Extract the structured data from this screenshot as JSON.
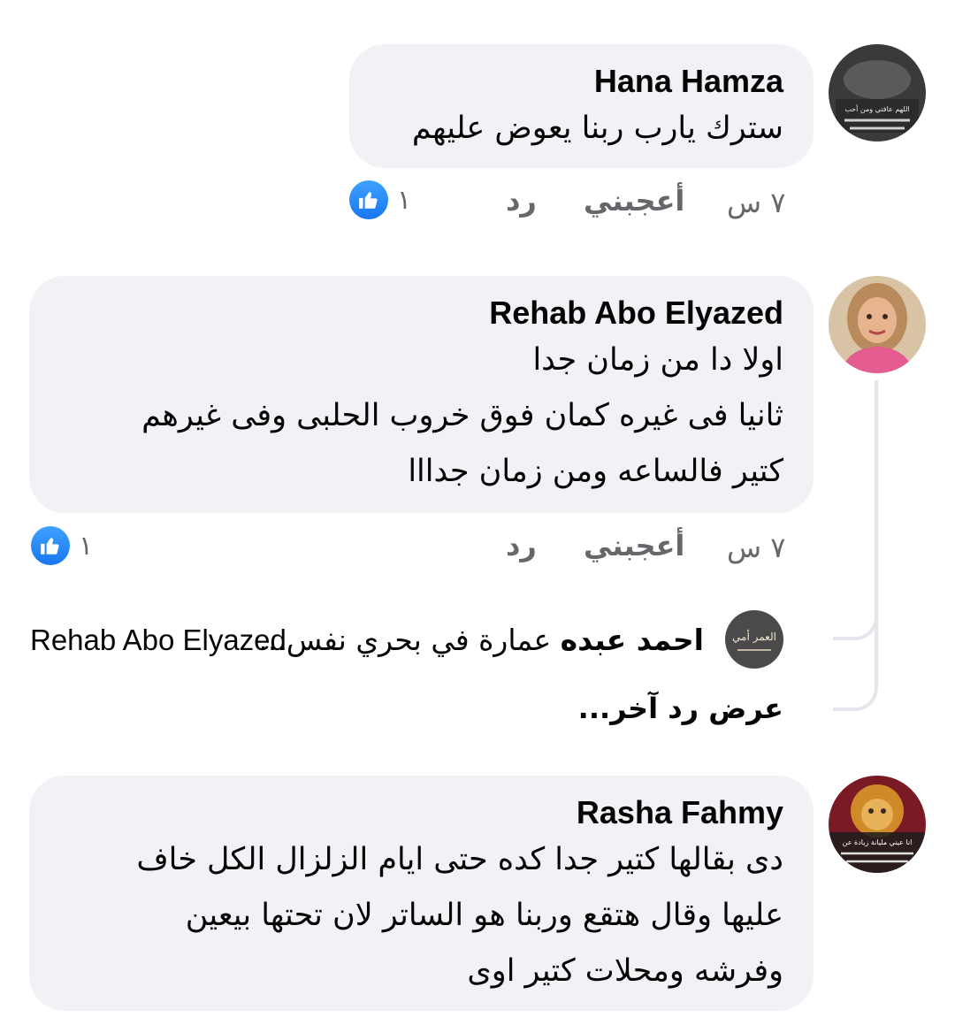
{
  "comments": [
    {
      "author": "Hana Hamza",
      "text": "سترك يارب ربنا يعوض عليهم",
      "time": "٧ س",
      "like_label": "أعجبني",
      "reply_label": "رد",
      "reaction_count": "١",
      "avatar_caption": "اللهم عافتي ومن أحب"
    },
    {
      "author": "Rehab Abo Elyazed",
      "text": "اولا دا من زمان جدا\nثانيا فى غيره كمان فوق خروب الحلبى وفى غيرهم\nكتير فالساعه ومن زمان جدااا",
      "time": "٧ س",
      "like_label": "أعجبني",
      "reply_label": "رد",
      "reaction_count": "١",
      "reply_preview": {
        "author": "احمد عبده",
        "text": "عمارة في بحري نفس...",
        "mention": "Rehab Abo Elyazed",
        "avatar_caption": "العمر أمي"
      },
      "more_replies_label": "عرض رد آخر..."
    },
    {
      "author": "Rasha Fahmy",
      "text": "دى بقالها كتير جدا كده حتى ايام الزلزال الكل خاف\nعليها وقال هتقع وربنا هو الساتر لان تحتها بيعين\nوفرشه ومحلات كتير اوى",
      "avatar_caption": "انا عيني مليانة زيادة عن"
    }
  ],
  "colors": {
    "bubble_bg": "#f0f2f5",
    "meta_text": "#65676b",
    "like_blue": "#1877f2",
    "thread_line": "#e4e6eb"
  },
  "icons": {
    "like_badge": "thumbs-up-icon"
  }
}
